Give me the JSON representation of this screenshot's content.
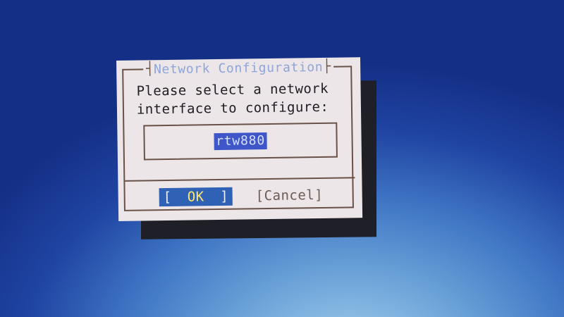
{
  "dialog": {
    "title": "Network Configuration",
    "prompt_lines": [
      "Please select a network",
      "interface to configure:"
    ],
    "interfaces": [
      {
        "name": "rtw880",
        "selected": true
      }
    ],
    "buttons": {
      "ok": {
        "left_bracket": "[",
        "label": "OK",
        "right_bracket": "]"
      },
      "cancel": {
        "text": "[Cancel]"
      }
    }
  },
  "colors": {
    "background": "#2b58b4",
    "dialog": "#ece6e8",
    "shadow": "#1f2027",
    "border": "#6a5148",
    "title": "#8da5d9",
    "selected_item": "#3f56c8",
    "ok_button": "#2f62b5",
    "ok_label": "#ffe56b"
  }
}
